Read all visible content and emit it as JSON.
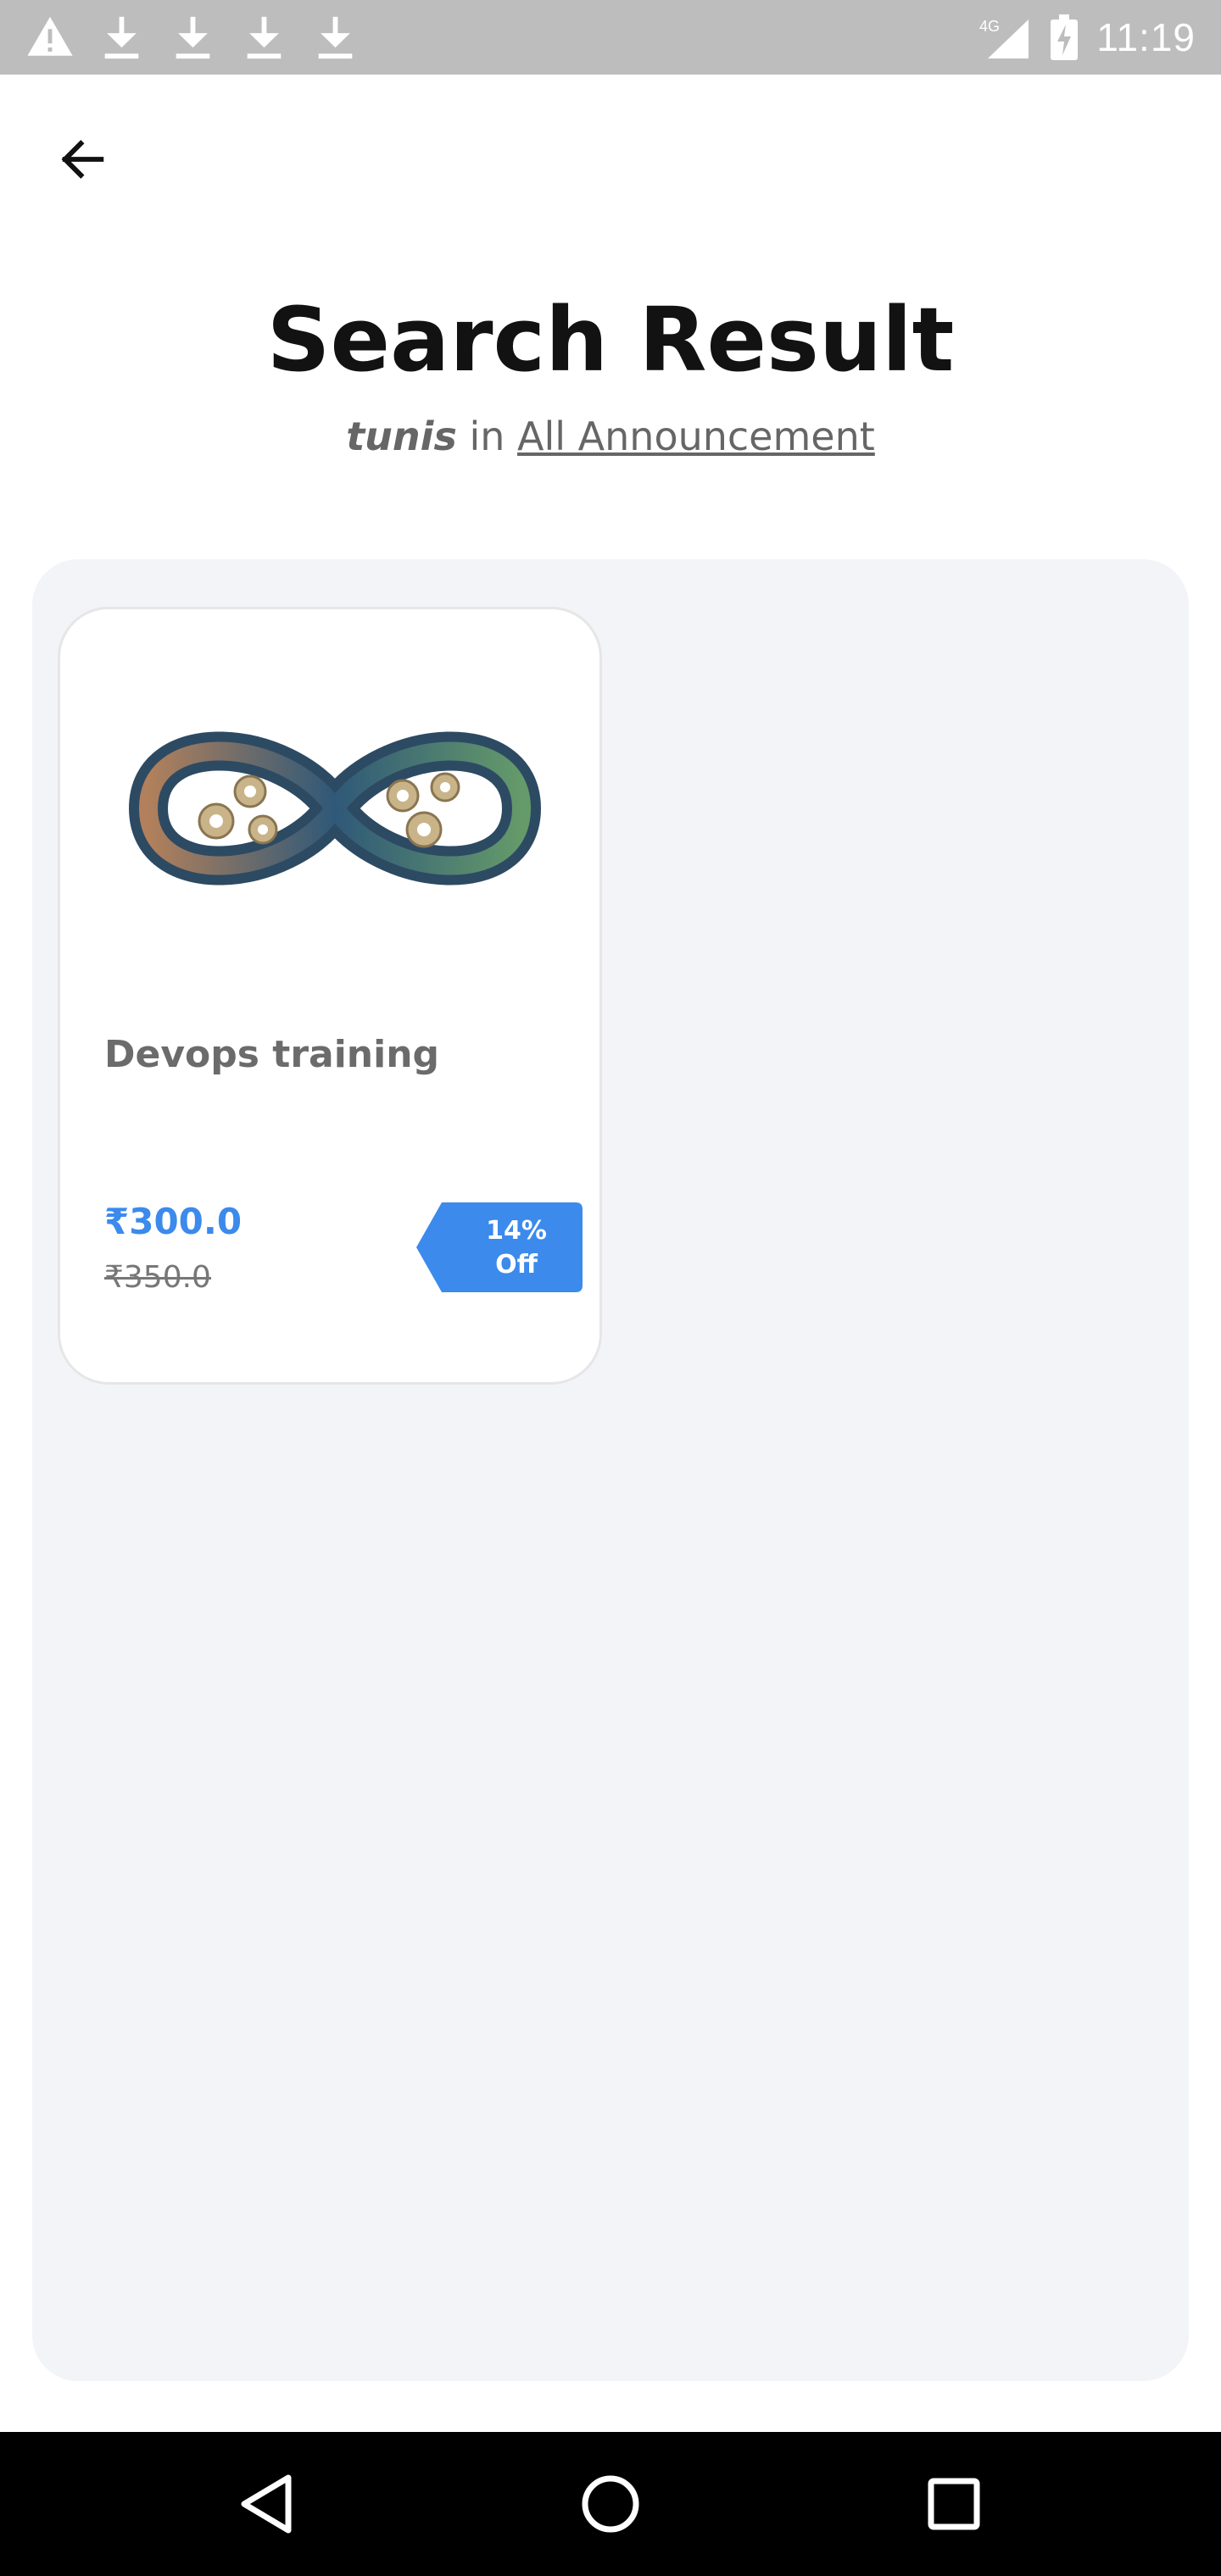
{
  "status_bar": {
    "time": "11:19",
    "network": "4G",
    "left_icons": [
      "warning-icon",
      "download-icon",
      "download-icon",
      "download-icon",
      "download-icon"
    ],
    "right_icons": [
      "signal-icon",
      "battery-charging-icon"
    ]
  },
  "header": {
    "back_icon": "arrow-left-icon",
    "title": "Search Result",
    "query": "tunis",
    "connector": "in",
    "category": "All Announcement"
  },
  "results": [
    {
      "image_icon": "devops-infinity-gears-image",
      "title": "Devops training",
      "price": "₹300.0",
      "original_price": "₹350.0",
      "discount_line1": "14%",
      "discount_line2": "Off"
    }
  ],
  "colors": {
    "accent_blue": "#3b8aec",
    "panel_bg": "#f3f4f8",
    "status_bar_bg": "#bdbdbd",
    "nav_bar_bg": "#000000"
  },
  "nav_bar": {
    "back_icon": "triangle-back-icon",
    "home_icon": "circle-home-icon",
    "recents_icon": "square-recents-icon"
  }
}
